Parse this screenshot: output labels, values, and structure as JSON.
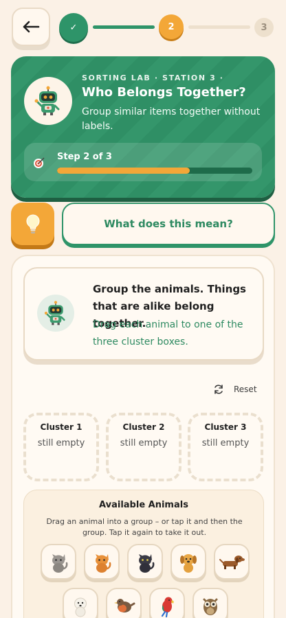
{
  "stepper": {
    "step1_mark": "✓",
    "step2_label": "2",
    "step3_label": "3",
    "current_step": 2,
    "total_steps": 3
  },
  "hero": {
    "kicker": "SORTING LAB · STATION 3 ·",
    "title": "Who Belongs Together?",
    "subtitle": "Group similar items together without labels.",
    "progress_label": "Step 2 of 3",
    "progress_fraction": 0.68
  },
  "hint": {
    "meaning_label": "What does this mean?"
  },
  "instruction": {
    "main": "Group the animals. Things that are alike belong together.",
    "sub": "Drag each animal to one of the three cluster boxes."
  },
  "reset_label": "Reset",
  "clusters": [
    {
      "title": "Cluster 1",
      "status": "still empty"
    },
    {
      "title": "Cluster 2",
      "status": "still empty"
    },
    {
      "title": "Cluster 3",
      "status": "still empty"
    }
  ],
  "pool": {
    "title": "Available Animals",
    "help": "Drag an animal into a group – or tap it and then the group. Tap it again to take it out.",
    "animals": [
      "gray-cat-icon",
      "orange-cat-icon",
      "black-cat-icon",
      "puppy-icon",
      "dachshund-icon",
      "white-dog-icon",
      "robin-icon",
      "parrot-icon",
      "owl-icon"
    ]
  },
  "colors": {
    "primary_green": "#2e9469",
    "accent_orange": "#f3a738",
    "background": "#fbf1e6"
  }
}
